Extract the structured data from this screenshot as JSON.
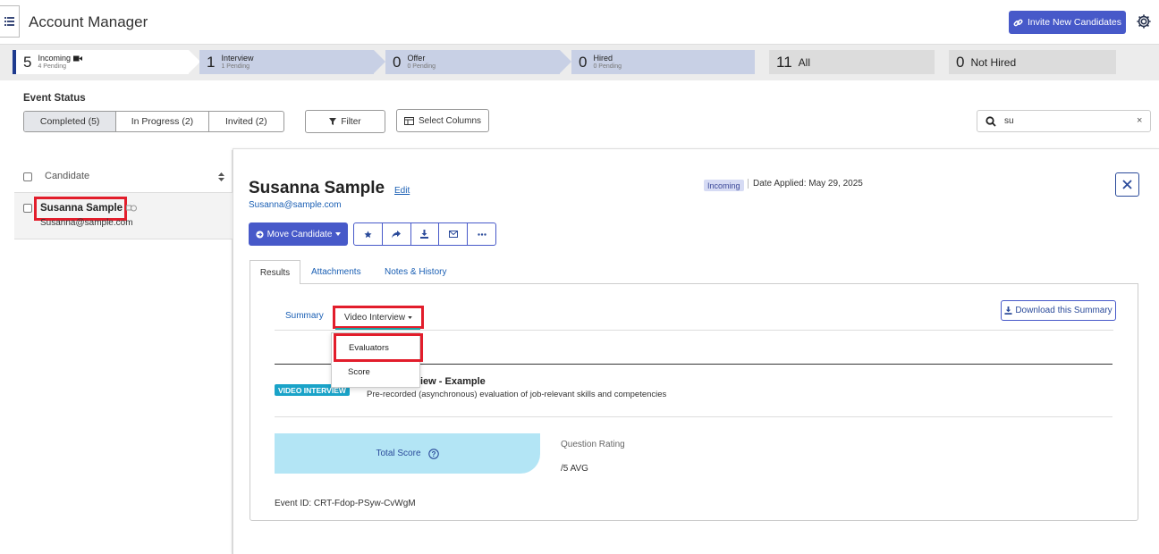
{
  "header": {
    "title": "Account Manager",
    "invite_label": "Invite New Candidates"
  },
  "pipeline": [
    {
      "count": "5",
      "label": "Incoming",
      "sub": "4 Pending"
    },
    {
      "count": "1",
      "label": "Interview",
      "sub": "1 Pending"
    },
    {
      "count": "0",
      "label": "Offer",
      "sub": "0 Pending"
    },
    {
      "count": "0",
      "label": "Hired",
      "sub": "0 Pending"
    },
    {
      "count": "11",
      "label": "All"
    },
    {
      "count": "0",
      "label": "Not Hired"
    }
  ],
  "filters": {
    "event_status_label": "Event Status",
    "segments": [
      "Completed (5)",
      "In Progress (2)",
      "Invited (2)"
    ],
    "active_segment": "Completed (5)",
    "filter_label": "Filter",
    "select_columns_label": "Select Columns",
    "search_value": "su"
  },
  "list": {
    "header": "Candidate",
    "rows": [
      {
        "name": "Susanna Sample",
        "email": "Susanna@sample.com"
      }
    ]
  },
  "candidate": {
    "name": "Susanna Sample",
    "edit_label": "Edit",
    "email": "Susanna@sample.com",
    "status_badge": "Incoming",
    "date_applied": "Date Applied: May 29, 2025",
    "move_label": "Move Candidate"
  },
  "tabs": [
    "Results",
    "Attachments",
    "Notes & History"
  ],
  "subtabs": {
    "summary": "Summary",
    "video": "Video Interview",
    "download": "Download this Summary"
  },
  "dropdown": [
    "Evaluators",
    "Score"
  ],
  "interview": {
    "badge": "VIDEO INTERVIEW",
    "title_visible": "iew - Example",
    "description": "Pre-recorded (asynchronous) evaluation of job-relevant skills and competencies",
    "total_score_label": "Total Score",
    "question_rating_label": "Question Rating",
    "avg": "/5 AVG",
    "event_id": "Event ID: CRT-Fdop-PSyw-CvWgM"
  },
  "colors": {
    "primary": "#4759c9",
    "link": "#1a5fb4",
    "highlight": "#e21d2b",
    "stage_active": "#ffffff",
    "stage_inactive": "#c8d0e5",
    "score_bg": "#b3e5f5"
  }
}
